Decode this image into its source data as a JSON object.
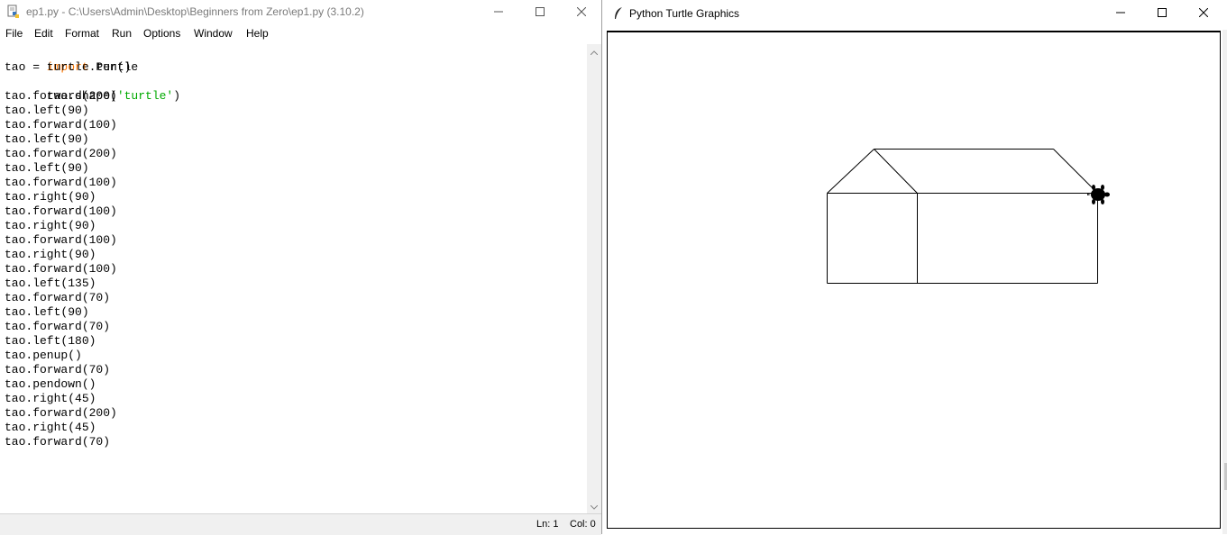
{
  "idle": {
    "title": "ep1.py - C:\\Users\\Admin\\Desktop\\Beginners from Zero\\ep1.py (3.10.2)",
    "menu": [
      "File",
      "Edit",
      "Format",
      "Run",
      "Options",
      "Window",
      "Help"
    ],
    "code_lines": [
      "import turtle",
      "tao = turtle.Pen()",
      "tao.shape('turtle')",
      "tao.forward(200)",
      "tao.left(90)",
      "tao.forward(100)",
      "tao.left(90)",
      "tao.forward(200)",
      "tao.left(90)",
      "tao.forward(100)",
      "tao.right(90)",
      "tao.forward(100)",
      "tao.right(90)",
      "tao.forward(100)",
      "tao.right(90)",
      "tao.forward(100)",
      "tao.left(135)",
      "tao.forward(70)",
      "tao.left(90)",
      "tao.forward(70)",
      "tao.left(180)",
      "tao.penup()",
      "tao.forward(70)",
      "tao.pendown()",
      "tao.right(45)",
      "tao.forward(200)",
      "tao.right(45)",
      "tao.forward(70)"
    ],
    "status": {
      "ln": "Ln: 1",
      "col": "Col: 0"
    },
    "syntax_colors": {
      "keyword": "#ff7700",
      "string": "#00aa00"
    }
  },
  "turtle_window": {
    "title": "Python Turtle Graphics",
    "icons": [
      "feather-icon",
      "minimize-icon",
      "maximize-icon",
      "close-icon"
    ],
    "turtle_heading": "east",
    "pen_color": "#000000"
  }
}
